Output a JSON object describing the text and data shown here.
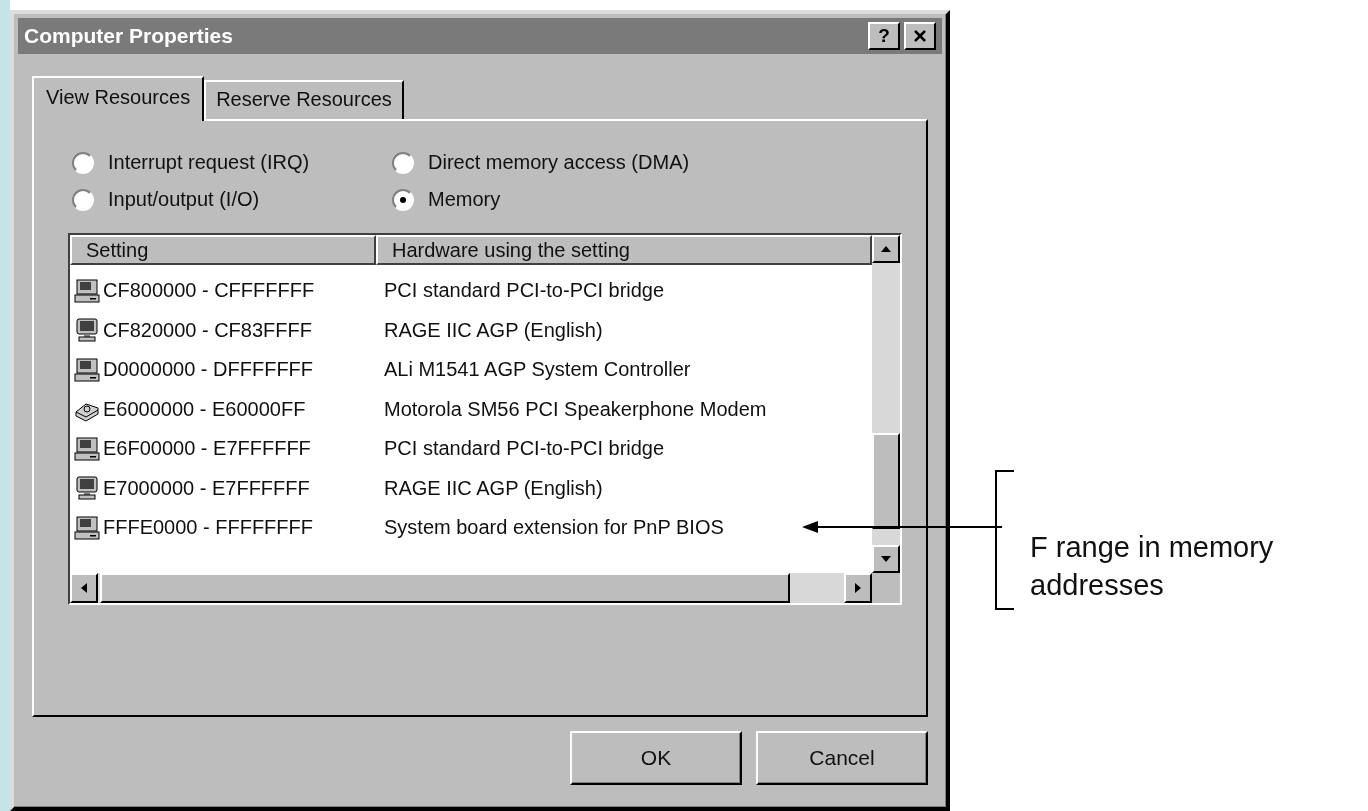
{
  "window": {
    "title": "Computer Properties",
    "buttons": [
      {
        "kind": "help",
        "label": "?"
      },
      {
        "kind": "close",
        "label": "×"
      }
    ]
  },
  "tabs": [
    {
      "label": "View Resources",
      "selected": true
    },
    {
      "label": "Reserve Resources",
      "selected": false
    }
  ],
  "options": [
    {
      "label": "Interrupt request (IRQ)",
      "selected": false
    },
    {
      "label": "Direct memory access (DMA)",
      "selected": false
    },
    {
      "label": "Input/output (I/O)",
      "selected": false
    },
    {
      "label": "Memory",
      "selected": true
    }
  ],
  "list": {
    "columns": [
      "Setting",
      "Hardware using the setting"
    ],
    "rows": [
      {
        "kind": "computer",
        "setting": "CF800000 - CFFFFFFF",
        "hardware": "PCI standard PCI-to-PCI bridge"
      },
      {
        "kind": "monitor",
        "setting": "CF820000 - CF83FFFF",
        "hardware": "RAGE IIC AGP (English)"
      },
      {
        "kind": "computer",
        "setting": "D0000000 - DFFFFFFF",
        "hardware": "ALi M1541 AGP System Controller"
      },
      {
        "kind": "modem",
        "setting": "E6000000 - E60000FF",
        "hardware": "Motorola SM56 PCI Speakerphone Modem"
      },
      {
        "kind": "computer",
        "setting": "E6F00000 - E7FFFFFF",
        "hardware": "PCI standard PCI-to-PCI bridge"
      },
      {
        "kind": "monitor",
        "setting": "E7000000 - E7FFFFFF",
        "hardware": "RAGE IIC AGP (English)"
      },
      {
        "kind": "computer",
        "setting": "FFFE0000 - FFFFFFFF",
        "hardware": "System board extension for PnP BIOS"
      }
    ]
  },
  "buttons": [
    {
      "label": "OK"
    },
    {
      "label": "Cancel"
    }
  ],
  "annotation": {
    "text": "F range in memory addresses"
  }
}
